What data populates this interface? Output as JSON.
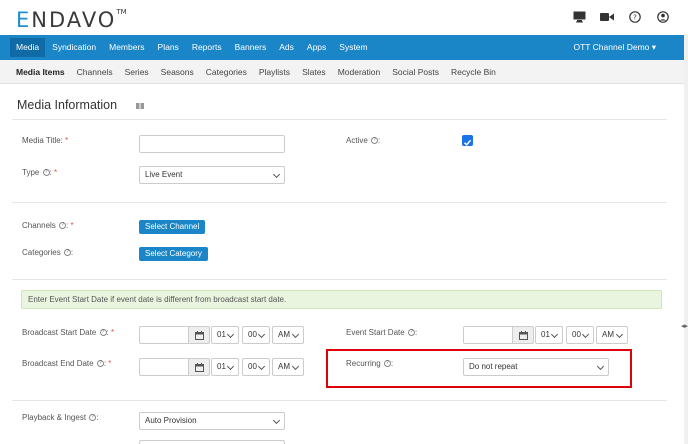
{
  "header": {
    "logo_text": "ENDAVO",
    "logo_first": "E",
    "logo_rest": "NDAVO",
    "logo_tm": "TM",
    "icons": [
      "monitor-icon",
      "video-camera-icon",
      "help-icon",
      "user-icon"
    ]
  },
  "main_nav": {
    "items": [
      "Media",
      "Syndication",
      "Members",
      "Plans",
      "Reports",
      "Banners",
      "Ads",
      "Apps",
      "System"
    ],
    "active": "Media",
    "account": "OTT Channel Demo ▾"
  },
  "sub_nav": {
    "items": [
      "Media Items",
      "Channels",
      "Series",
      "Seasons",
      "Categories",
      "Playlists",
      "Slates",
      "Moderation",
      "Social Posts",
      "Recycle Bin"
    ],
    "active": "Media Items"
  },
  "page": {
    "title": "Media Information"
  },
  "form": {
    "media_title": {
      "label": "Media Title:",
      "required": "*",
      "value": ""
    },
    "active": {
      "label": "Active",
      "checked": true
    },
    "type": {
      "label": "Type",
      "required": "*",
      "value": "Live Event"
    },
    "channels": {
      "label": "Channels",
      "required": "*",
      "button": "Select Channel"
    },
    "categories": {
      "label": "Categories",
      "button": "Select Category"
    },
    "alert_text": "Enter Event Start Date if event date is different from broadcast start date.",
    "broadcast_start": {
      "label": "Broadcast Start Date",
      "required": "*",
      "hour": "01",
      "minute": "00",
      "ampm": "AM"
    },
    "event_start": {
      "label": "Event Start Date",
      "hour": "01",
      "minute": "00",
      "ampm": "AM"
    },
    "broadcast_end": {
      "label": "Broadcast End Date",
      "required": "*",
      "hour": "01",
      "minute": "00",
      "ampm": "AM"
    },
    "recurring": {
      "label": "Recurring",
      "value": "Do not repeat"
    },
    "playback": {
      "label": "Playback & Ingest",
      "value": "Auto Provision"
    }
  },
  "colors": {
    "nav_blue": "#1a86c8",
    "nav_active": "#0f6aa5",
    "highlight_red": "#e0000a",
    "checkbox_blue": "#1a73e8"
  }
}
